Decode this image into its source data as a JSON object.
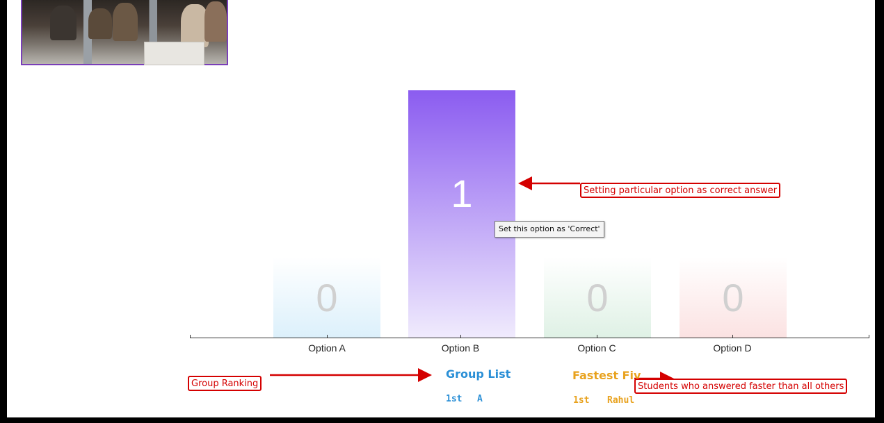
{
  "photo": {
    "description_icon": "classroom-photo"
  },
  "chart_data": {
    "type": "bar",
    "categories": [
      "Option A",
      "Option B",
      "Option C",
      "Option D"
    ],
    "values": [
      0,
      1,
      0,
      0
    ],
    "selected_index": 1,
    "ylim": [
      0,
      1
    ],
    "colors": [
      "#d6eefa",
      "#8b5cf0",
      "#d8efe0",
      "#fbe0e0"
    ],
    "title": "",
    "xlabel": "",
    "ylabel": ""
  },
  "tooltip": {
    "text": "Set this option as 'Correct'"
  },
  "annotations": {
    "correct_answer": "Setting particular option as correct answer",
    "group_ranking": "Group Ranking",
    "fastest_students": "Students who answered faster than all others"
  },
  "group_list": {
    "title": "Group List",
    "title_color": "#2a8fd6",
    "entries": [
      {
        "rank": "1st",
        "name": "A"
      }
    ]
  },
  "fastest_five": {
    "title": "Fastest Five",
    "title_visible": "Fastest Fiv",
    "title_color": "#e8a21e",
    "entries": [
      {
        "rank": "1st",
        "name": "Rahul"
      }
    ]
  },
  "annotation_color": "#d40000"
}
